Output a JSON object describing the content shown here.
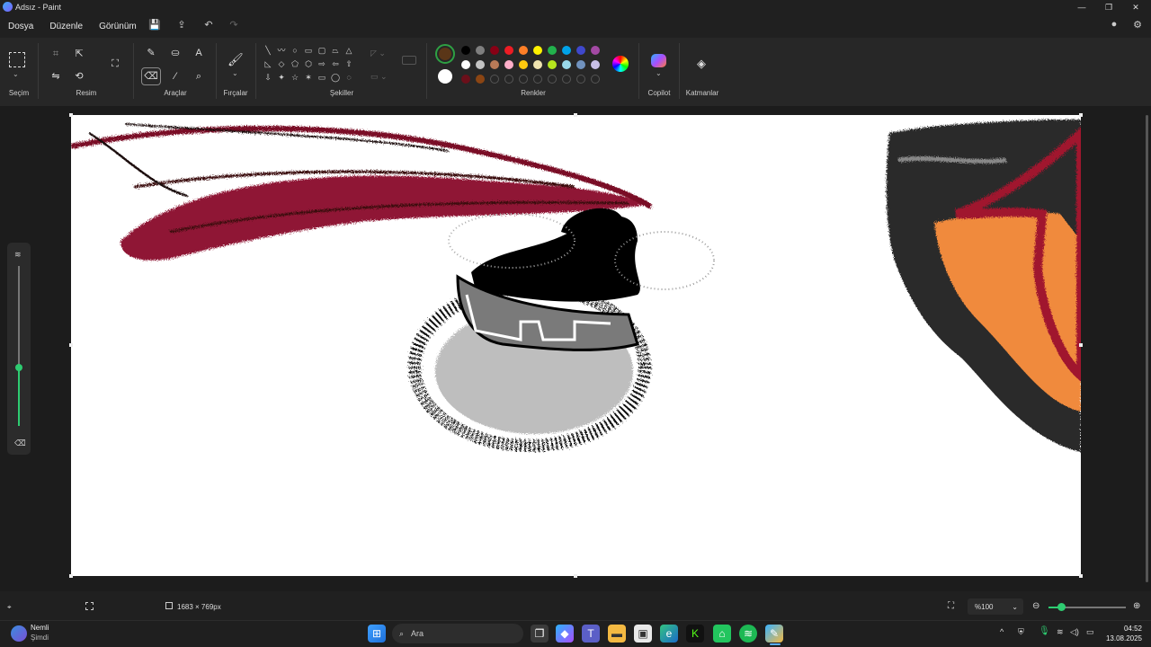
{
  "window": {
    "title": "Adsız - Paint",
    "controls": [
      "—",
      "❐",
      "✕"
    ]
  },
  "menu": {
    "items": [
      "Dosya",
      "Düzenle",
      "Görünüm"
    ]
  },
  "ribbon": {
    "groups": {
      "selection": "Seçim",
      "image": "Resim",
      "tools": "Araçlar",
      "brushes": "Fırçalar",
      "shapes": "Şekiller",
      "colors": "Renkler",
      "copilot": "Copilot",
      "layers": "Katmanlar"
    },
    "colors": {
      "primary": "#5a3618",
      "secondary": "#ffffff",
      "palette_row1": [
        "#000000",
        "#7f7f7f",
        "#880015",
        "#ed1c24",
        "#ff7f27",
        "#fff200",
        "#22b14c",
        "#00a2e8",
        "#3f48cc",
        "#a349a4"
      ],
      "palette_row2": [
        "#ffffff",
        "#c3c3c3",
        "#b97a57",
        "#ffaec9",
        "#ffc90e",
        "#efe4b0",
        "#b5e61d",
        "#99d9ea",
        "#7092be",
        "#c8bfe7"
      ],
      "palette_row3": [
        "#6b0f1a",
        "#8b4513",
        "",
        "",
        "",
        "",
        "",
        "",
        "",
        ""
      ]
    }
  },
  "status": {
    "canvas_size": "1683 × 769px",
    "zoom": "%100"
  },
  "taskbar": {
    "notification_title": "Nemli",
    "notification_sub": "Şimdi",
    "search_placeholder": "Ara",
    "time": "04:52",
    "date": "13.08.2025"
  }
}
